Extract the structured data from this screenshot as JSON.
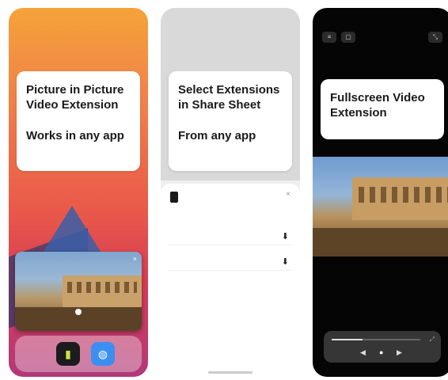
{
  "screens": [
    {
      "caption_lines": [
        "Picture in Picture",
        "Video Extension"
      ],
      "caption_sub": "Works in any app"
    },
    {
      "caption_lines": [
        "Select Extensions",
        "in Share Sheet"
      ],
      "caption_sub": "From any app",
      "sheet_rows": [
        "",
        ""
      ]
    },
    {
      "caption_lines": [
        "Fullscreen Video",
        "Extension"
      ],
      "playback_progress": 0.35
    }
  ],
  "icons": {
    "pip_close": "×",
    "sheet_close": "×",
    "row_1": "⬇",
    "row_2": "⬇",
    "prev": "◀",
    "play": "●",
    "next": "▶",
    "expand": "⤢",
    "top_1": "≡",
    "top_2": "▢",
    "top_3": "⤡",
    "app_1": "▮",
    "app_2": "◍"
  },
  "colors": {
    "caption_bg": "#ffffff",
    "phone_1_bg": "#ef7d4a",
    "phone_3_bg": "#050505"
  }
}
